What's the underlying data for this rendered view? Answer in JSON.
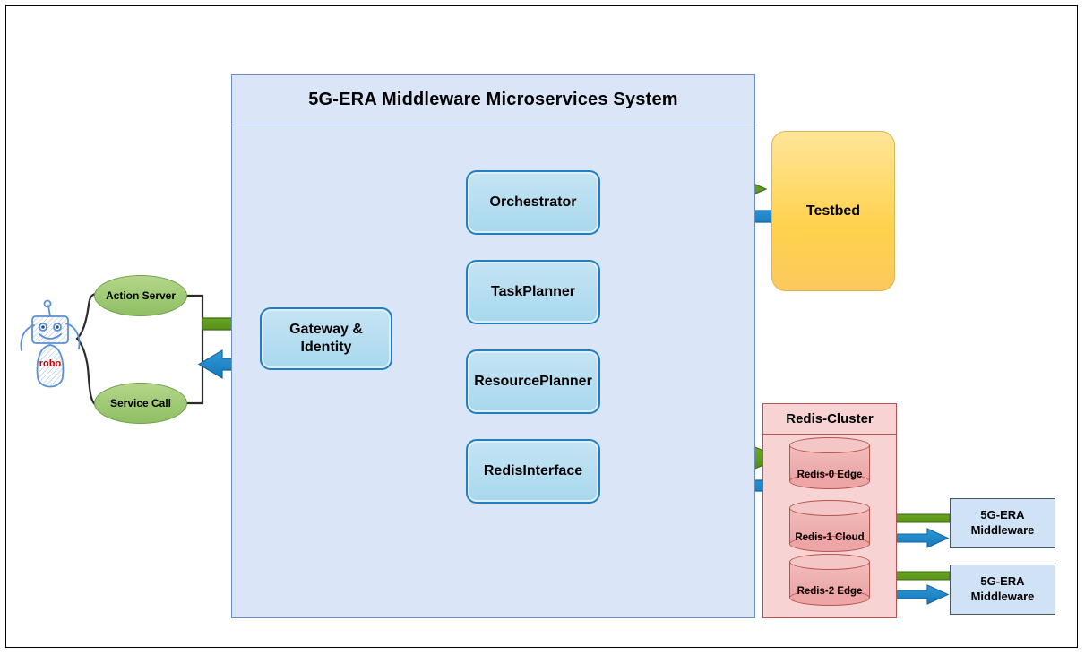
{
  "diagram": {
    "title": "5G-ERA Middleware Microservices System",
    "system_container": {
      "title": "5G-ERA Middleware Microservices System",
      "services": [
        {
          "id": "orchestrator",
          "label": "Orchestrator"
        },
        {
          "id": "taskplanner",
          "label": "TaskPlanner"
        },
        {
          "id": "resourceplanner",
          "label": "ResourcePlanner"
        },
        {
          "id": "redisinterface",
          "label": "RedisInterface"
        }
      ],
      "gateway": {
        "label": "Gateway &\nIdentity",
        "line1": "Gateway &",
        "line2": "Identity"
      }
    },
    "testbed": {
      "label": "Testbed"
    },
    "redis_cluster": {
      "title": "Redis-Cluster",
      "nodes": [
        {
          "id": "redis-0",
          "label": "Redis-0 Edge"
        },
        {
          "id": "redis-1",
          "label": "Redis-1 Cloud"
        },
        {
          "id": "redis-2",
          "label": "Redis-2 Edge"
        }
      ]
    },
    "external_middleware": [
      {
        "id": "mw-1",
        "line1": "5G-ERA",
        "line2": "Middleware"
      },
      {
        "id": "mw-2",
        "line1": "5G-ERA",
        "line2": "Middleware"
      }
    ],
    "client_interfaces": [
      {
        "id": "action-server",
        "label": "Action Server"
      },
      {
        "id": "service-call",
        "label": "Service Call"
      }
    ],
    "robot": {
      "body_label": "robo",
      "icon": "robot-sketch-icon"
    },
    "colors": {
      "green_arrow": "#5e9e20",
      "green_arrow_outline": "#3d6b13",
      "blue_arrow": "#1e8fd2",
      "blue_arrow_outline": "#1268a0",
      "container_fill": "#dae6f7",
      "container_border": "#6c8ebf",
      "service_fill": "#a8d8ee",
      "service_border": "#1f7fc0",
      "testbed_fill": "#ffd24d",
      "testbed_border": "#d6b656",
      "redis_cluster_fill": "#f7d3d3",
      "redis_cluster_border": "#b85450",
      "redis_node_fill": "#eaa3a3",
      "ellipse_fill": "#8fbf63",
      "ellipse_border": "#6f9f4a",
      "middleware_box_fill": "#cfe2f6",
      "middleware_box_border": "#4a5560",
      "connector_line": "#2b2b2b",
      "robot_sketch": "#5b8fd4",
      "robot_label": "#cc0000"
    }
  }
}
